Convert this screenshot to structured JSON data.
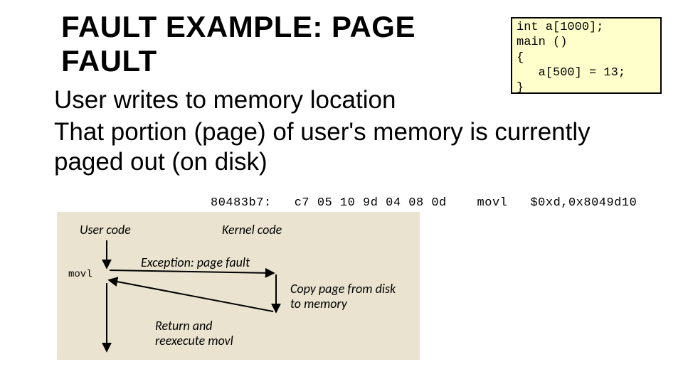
{
  "title": "FAULT EXAMPLE: PAGE FAULT",
  "code_box": "int a[1000];\nmain ()\n{\n   a[500] = 13;\n}",
  "body_line1": "User writes to memory location",
  "body_line2": "That portion (page) of user's memory is currently paged out (on disk)",
  "asm_line": "80483b7:   c7 05 10 9d 04 08 0d    movl   $0xd,0x8049d10",
  "diagram": {
    "user_code": "User code",
    "kernel_code": "Kernel code",
    "movl": "movl",
    "exception": "Exception: page fault",
    "copy": "Copy page from disk to memory",
    "return": "Return and reexecute movl"
  }
}
